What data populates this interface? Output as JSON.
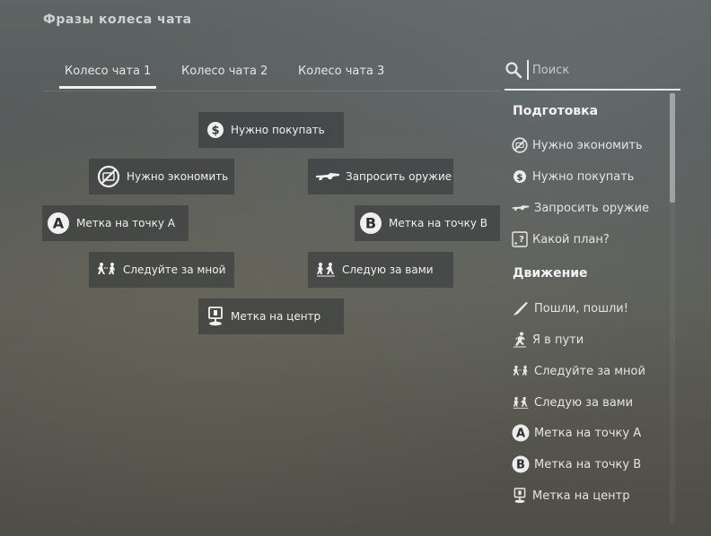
{
  "header": {
    "title": "Фразы колеса чата"
  },
  "tabs": [
    {
      "label": "Колесо чата 1",
      "active": true
    },
    {
      "label": "Колесо чата 2",
      "active": false
    },
    {
      "label": "Колесо чата 3",
      "active": false
    }
  ],
  "search": {
    "placeholder": "Поиск",
    "value": ""
  },
  "wheel": {
    "items": [
      {
        "label": "Нужно покупать",
        "icon": "dollar-icon"
      },
      {
        "label": "Нужно экономить",
        "icon": "no-money-icon"
      },
      {
        "label": "Запросить оружие",
        "icon": "rifle-icon"
      },
      {
        "label": "Метка на точку A",
        "icon": "letter-a-icon"
      },
      {
        "label": "Метка на точку B",
        "icon": "letter-b-icon"
      },
      {
        "label": "Следуйте за мной",
        "icon": "follow-me-icon"
      },
      {
        "label": "Следую за вами",
        "icon": "following-you-icon"
      },
      {
        "label": "Метка на центр",
        "icon": "mid-marker-icon"
      }
    ]
  },
  "panel": {
    "sections": [
      {
        "title": "Подготовка",
        "items": [
          {
            "label": "Нужно экономить",
            "icon": "no-money-icon"
          },
          {
            "label": "Нужно покупать",
            "icon": "dollar-icon"
          },
          {
            "label": "Запросить оружие",
            "icon": "rifle-icon"
          },
          {
            "label": "Какой план?",
            "icon": "plan-icon"
          }
        ]
      },
      {
        "title": "Движение",
        "items": [
          {
            "label": "Пошли, пошли!",
            "icon": "knife-icon"
          },
          {
            "label": "Я в пути",
            "icon": "running-icon"
          },
          {
            "label": "Следуйте за мной",
            "icon": "follow-me-icon"
          },
          {
            "label": "Следую за вами",
            "icon": "following-you-icon"
          },
          {
            "label": "Метка на точку A",
            "icon": "letter-a-icon"
          },
          {
            "label": "Метка на точку B",
            "icon": "letter-b-icon"
          },
          {
            "label": "Метка на центр",
            "icon": "mid-marker-icon"
          }
        ]
      }
    ]
  },
  "colors": {
    "text": "#e8e8e8",
    "tile": "#323436",
    "underline": "#f2f2f2"
  }
}
